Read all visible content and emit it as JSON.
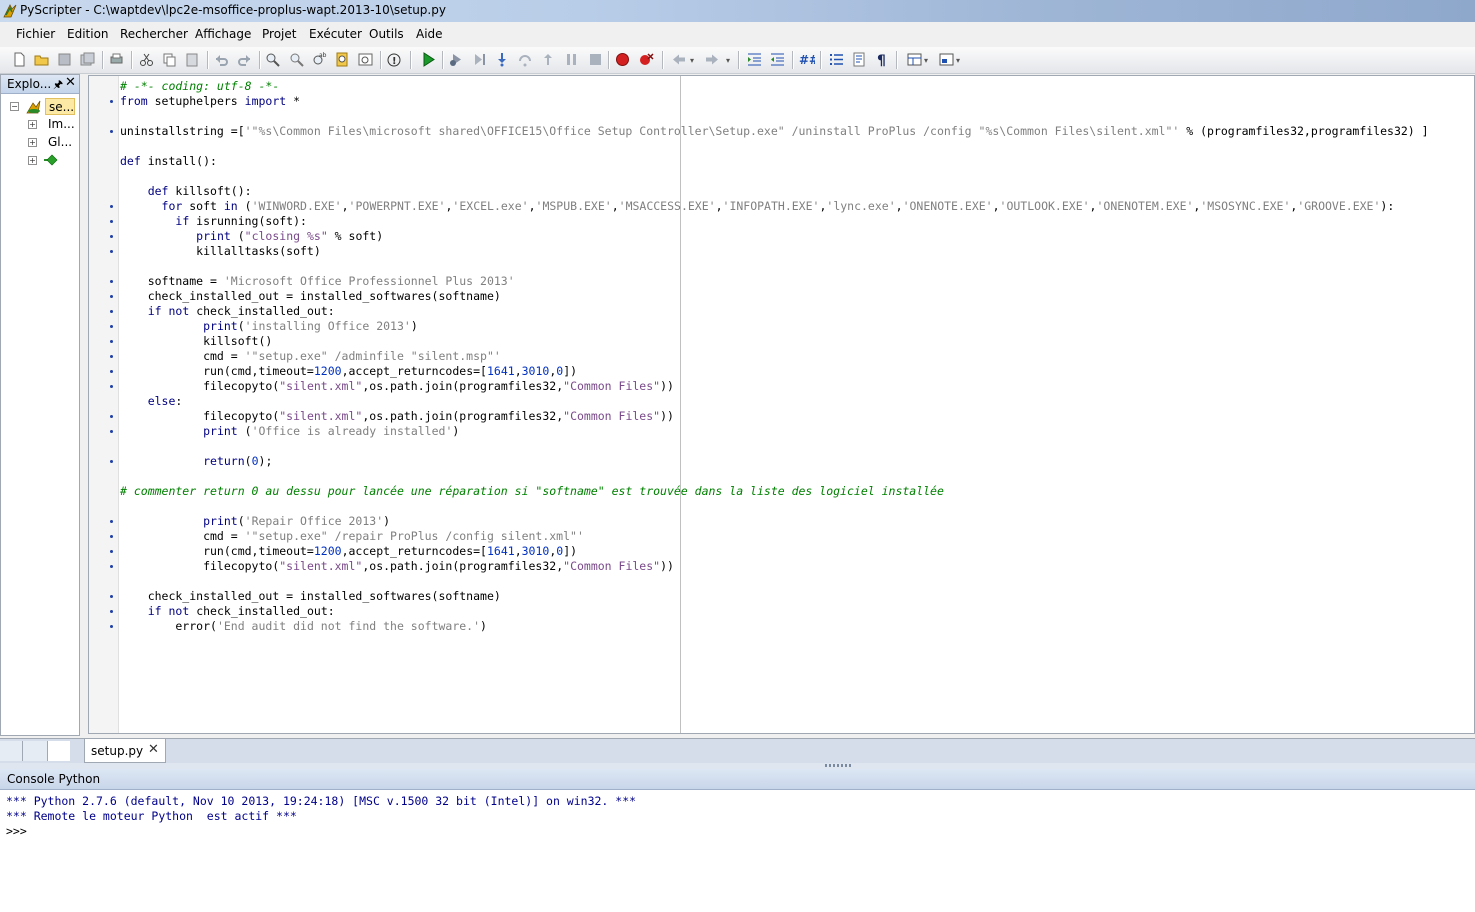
{
  "window": {
    "title": "PyScripter - C:\\waptdev\\lpc2e-msoffice-proplus-wapt.2013-10\\setup.py"
  },
  "menu": {
    "items": [
      "Fichier",
      "Edition",
      "Rechercher",
      "Affichage",
      "Projet",
      "Exécuter",
      "Outils",
      "Aide"
    ]
  },
  "explorer": {
    "title": "Explo...",
    "items": [
      "se...",
      "Im...",
      "Gl...",
      ""
    ]
  },
  "editor": {
    "tab_label": "setup.py",
    "lines": [
      "# -*- coding: utf-8 -*-",
      "from setuphelpers import *",
      "",
      "uninstallstring =['\"%s\\Common Files\\microsoft shared\\OFFICE15\\Office Setup Controller\\Setup.exe\" /uninstall ProPlus /config \"%s\\Common Files\\silent.xml\"' % (programfiles32,programfiles32) ]",
      "",
      "def install():",
      "",
      "    def killsoft():",
      "      for soft in ('WINWORD.EXE','POWERPNT.EXE','EXCEL.exe','MSPUB.EXE','MSACCESS.EXE','INFOPATH.EXE','lync.exe','ONENOTE.EXE','OUTLOOK.EXE','ONENOTEM.EXE','MSOSYNC.EXE','GROOVE.EXE'):",
      "        if isrunning(soft):",
      "           print (\"closing %s\" % soft)",
      "           killalltasks(soft)",
      "",
      "    softname = 'Microsoft Office Professionnel Plus 2013'",
      "    check_installed_out = installed_softwares(softname)",
      "    if not check_installed_out:",
      "            print('installing Office 2013')",
      "            killsoft()",
      "            cmd = '\"setup.exe\" /adminfile \"silent.msp\"'",
      "            run(cmd,timeout=1200,accept_returncodes=[1641,3010,0])",
      "            filecopyto(\"silent.xml\",os.path.join(programfiles32,\"Common Files\"))",
      "    else:",
      "            filecopyto(\"silent.xml\",os.path.join(programfiles32,\"Common Files\"))",
      "            print ('Office is already installed')",
      "",
      "            return(0);",
      "",
      "# commenter return 0 au dessu pour lancée une réparation si \"softname\" est trouvée dans la liste des logiciel installée",
      "",
      "            print('Repair Office 2013')",
      "            cmd = '\"setup.exe\" /repair ProPlus /config silent.xml\"'",
      "            run(cmd,timeout=1200,accept_returncodes=[1641,3010,0])",
      "            filecopyto(\"silent.xml\",os.path.join(programfiles32,\"Common Files\"))",
      "",
      "    check_installed_out = installed_softwares(softname)",
      "    if not check_installed_out:",
      "        error('End audit did not find the software.')"
    ],
    "bullet_lines": [
      1,
      3,
      8,
      9,
      10,
      11,
      13,
      14,
      15,
      16,
      17,
      18,
      19,
      20,
      22,
      23,
      25,
      29,
      30,
      31,
      32,
      34,
      35,
      36
    ]
  },
  "console": {
    "title": "Console Python",
    "lines": [
      "*** Python 2.7.6 (default, Nov 10 2013, 19:24:18) [MSC v.1500 32 bit (Intel)] on win32. ***",
      "*** Remote le moteur Python  est actif ***",
      ">>>"
    ]
  },
  "colors": {
    "keyword": "#000080",
    "string": "#808080",
    "number": "#0030c0",
    "comment": "#008000",
    "console_text": "#00008b"
  }
}
